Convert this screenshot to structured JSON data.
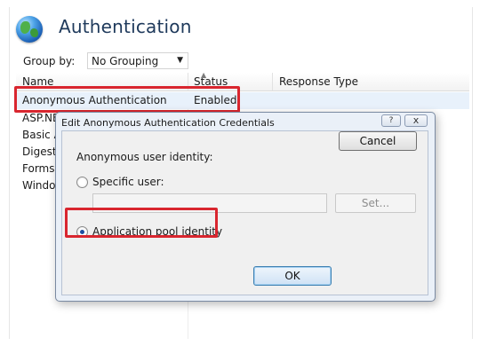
{
  "page": {
    "title": "Authentication"
  },
  "toolbar": {
    "group_by_label": "Group by:",
    "group_by_value": "No Grouping"
  },
  "list": {
    "columns": [
      "Name",
      "Status",
      "Response Type"
    ],
    "rows": [
      {
        "name": "Anonymous Authentication",
        "status": "Enabled"
      },
      {
        "name": "ASP.NE",
        "status": ""
      },
      {
        "name": "Basic A",
        "status": ""
      },
      {
        "name": "Digest A",
        "status": ""
      },
      {
        "name": "Forms A",
        "status": ""
      },
      {
        "name": "Window",
        "status": ""
      }
    ]
  },
  "dialog": {
    "title": "Edit Anonymous Authentication Credentials",
    "help_glyph": "?",
    "close_glyph": "x",
    "identity_label": "Anonymous user identity:",
    "specific_user_label": "Specific user:",
    "specific_user_value": "",
    "set_label": "Set...",
    "app_pool_label": "Application pool identity",
    "selected_option": "Application pool identity",
    "ok_label": "OK",
    "cancel_label": "Cancel"
  },
  "colors": {
    "highlight": "#d9262f",
    "title": "#1e395b",
    "dialog_frame": "#eaf0f8"
  },
  "icons": {
    "page_icon": "globe-icon",
    "dropdown": "chevron-down-icon"
  }
}
